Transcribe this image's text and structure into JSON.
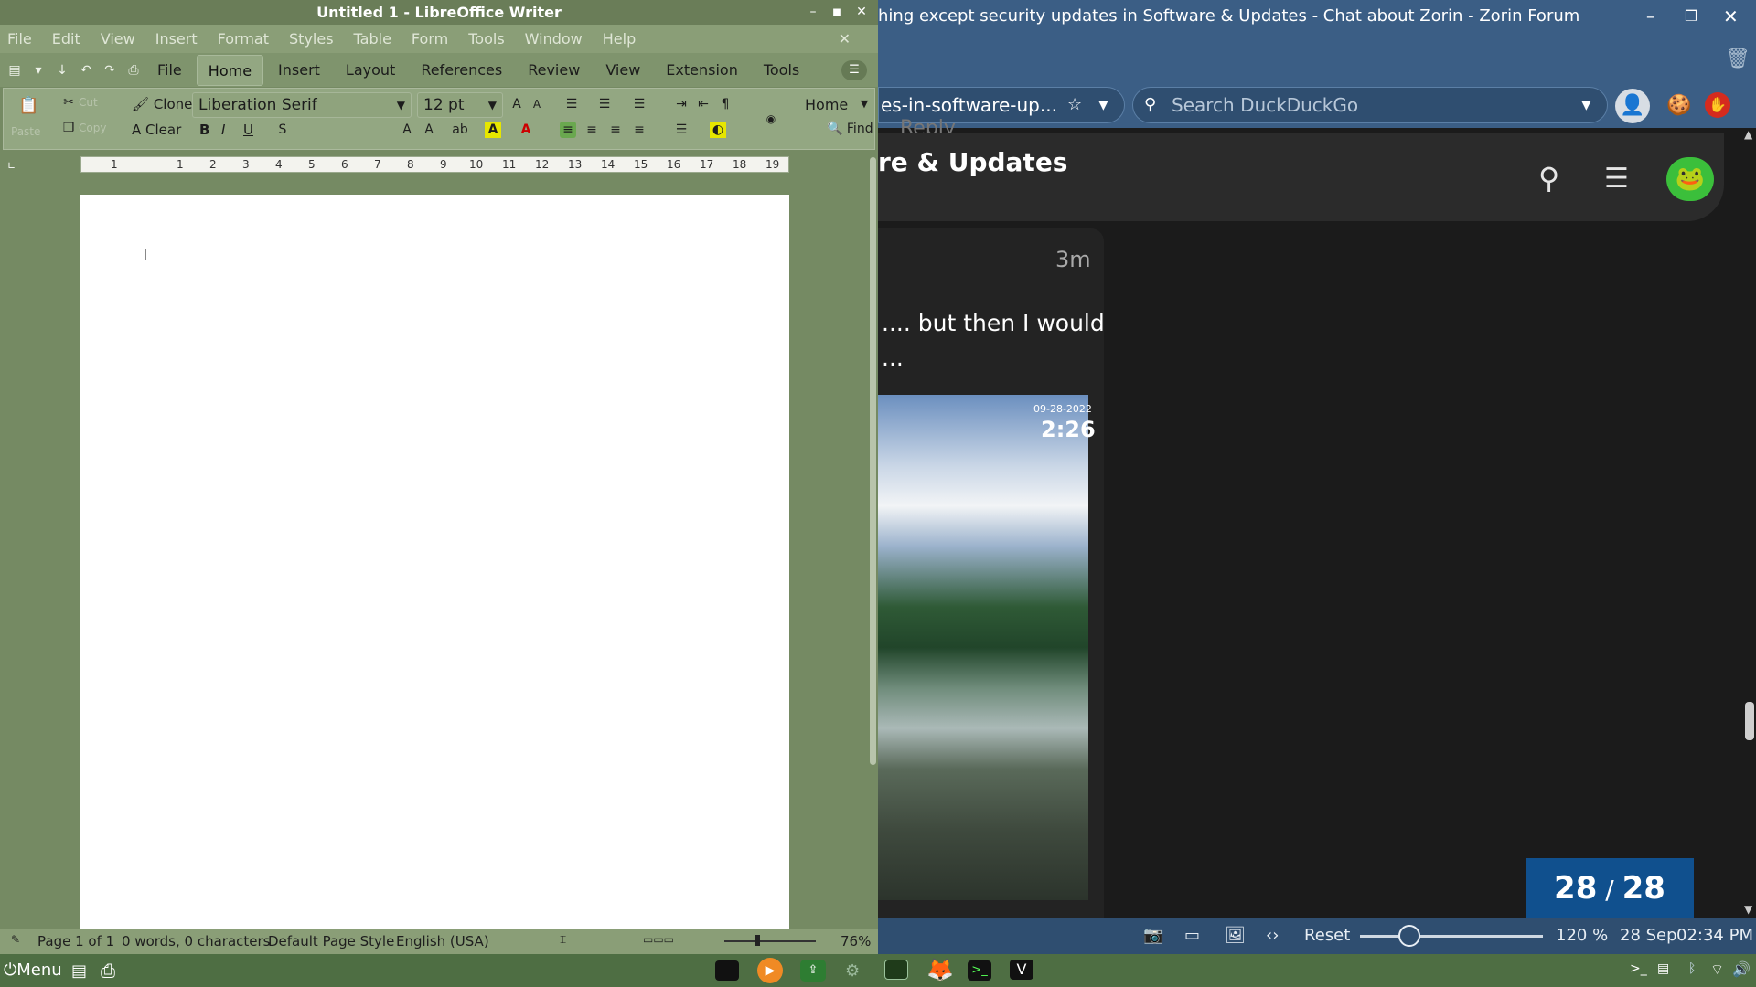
{
  "writer": {
    "title": "Untitled 1 - LibreOffice Writer",
    "window_controls": {
      "minimize": "–",
      "maximize": "■",
      "close": "✕"
    },
    "menubar": [
      "File",
      "Edit",
      "View",
      "Insert",
      "Format",
      "Styles",
      "Table",
      "Form",
      "Tools",
      "Window",
      "Help"
    ],
    "close_doc": "✕",
    "tabs": [
      "File",
      "Home",
      "Insert",
      "Layout",
      "References",
      "Review",
      "View",
      "Extension",
      "Tools"
    ],
    "active_tab": "Home",
    "toolbar": {
      "paste": "Paste",
      "cut": "Cut",
      "copy": "Copy",
      "clone": "Clone",
      "clear": "Clear",
      "font_name": "Liberation Serif",
      "font_size": "12 pt",
      "home_dropdown": "Home",
      "find": "Find",
      "bold": "B",
      "italic": "I",
      "underline": "U"
    },
    "ruler": [
      "1",
      "1",
      "2",
      "3",
      "4",
      "5",
      "6",
      "7",
      "8",
      "9",
      "10",
      "11",
      "12",
      "13",
      "14",
      "15",
      "16",
      "17",
      "18",
      "19"
    ],
    "status": {
      "page": "Page 1 of 1",
      "words": "0 words, 0 characters",
      "style": "Default Page Style",
      "language": "English (USA)",
      "zoom": "76%"
    }
  },
  "browser": {
    "title": "hing except security updates in Software & Updates - Chat about Zorin - Zorin Forum",
    "url": "es-in-software-up...",
    "search_placeholder": "Search DuckDuckGo",
    "forum_title": "re & Updates",
    "overlap_text": "Reply",
    "post_time": "3m",
    "post_text_line1": ".... but then I would",
    "post_text_line2": "...",
    "image_date": "09-28-2022",
    "image_time": "2:26",
    "counter_current": "28",
    "counter_sep": "/",
    "counter_total": "28",
    "status": {
      "reset": "Reset",
      "zoom": "120 %",
      "date": "28 Sep",
      "time": "02:34 PM"
    },
    "zoom_slider_level": 0.27
  },
  "taskbar": {
    "menu": "Menu"
  },
  "colors": {
    "lo_green": "#758a63",
    "browser_blue": "#3b5e85",
    "counter_blue": "#10508e",
    "taskbar": "#4e6e43"
  }
}
